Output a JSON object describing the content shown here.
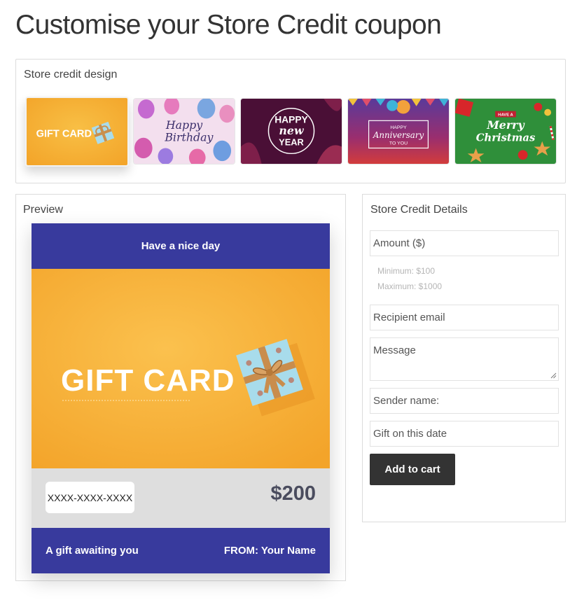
{
  "page_title": "Customise your Store Credit coupon",
  "design": {
    "label": "Store credit design",
    "thumbnails": [
      {
        "id": "gift-card",
        "text": "GIFT CARD",
        "selected": true
      },
      {
        "id": "birthday",
        "text_lines": [
          "Happy",
          "Birthday"
        ]
      },
      {
        "id": "new-year",
        "text_lines": [
          "HAPPY",
          "new",
          "YEAR"
        ]
      },
      {
        "id": "anniversary",
        "text_lines": [
          "HAPPY",
          "Anniversary",
          "TO YOU"
        ]
      },
      {
        "id": "christmas",
        "text_lines": [
          "HAVE A",
          "Merry",
          "Christmas"
        ]
      }
    ]
  },
  "preview": {
    "label": "Preview",
    "card": {
      "header": "Have a nice day",
      "image_text": "GIFT CARD",
      "code": "XXXX-XXXX-XXXX",
      "amount": "$200",
      "footer_left": "A gift awaiting you",
      "footer_right": "FROM: Your Name"
    }
  },
  "details": {
    "label": "Store Credit Details",
    "amount_placeholder": "Amount ($)",
    "minimum": "Minimum: $100",
    "maximum": "Maximum: $1000",
    "email_placeholder": "Recipient email",
    "message_placeholder": "Message",
    "sender_placeholder": "Sender name:",
    "date_placeholder": "Gift on this date",
    "add_to_cart": "Add to cart"
  },
  "colors": {
    "card_blue": "#383a9d",
    "card_orange": "#f7b13a",
    "button_dark": "#333333",
    "birthday_bg": "#f3dfee",
    "new_year_bg": "#4a0f36",
    "anniversary_bg": "#7a2a7a",
    "christmas_bg": "#2f8f3a"
  },
  "icons": [
    "gift-box-icon",
    "balloons-icon",
    "resize-grip-icon"
  ]
}
